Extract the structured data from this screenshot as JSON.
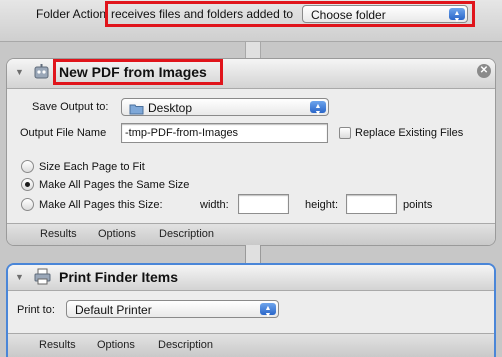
{
  "workflow_header": {
    "prefix_label": "Folder Action",
    "trigger_label": "receives files and folders added to",
    "folder_popup_value": "Choose folder"
  },
  "action1": {
    "title": "New PDF from Images",
    "save_output_label": "Save Output to:",
    "save_output_value": "Desktop",
    "output_file_name_label": "Output File Name",
    "output_file_name_value": "-tmp-PDF-from-Images",
    "replace_existing_label": "Replace Existing Files",
    "radio_size_each": "Size Each Page to Fit",
    "radio_make_same": "Make All Pages the Same Size",
    "radio_make_this": "Make All Pages this Size:",
    "width_label": "width:",
    "width_value": "",
    "height_label": "height:",
    "height_value": "",
    "points_label": "points",
    "footer_tabs": [
      "Results",
      "Options",
      "Description"
    ]
  },
  "action2": {
    "title": "Print Finder Items",
    "print_to_label": "Print to:",
    "print_to_value": "Default Printer",
    "footer_tabs": [
      "Results",
      "Options",
      "Description"
    ]
  },
  "colors": {
    "highlight_red": "#e0141b",
    "selected_blue": "#4a86d8",
    "popup_blue": "#2a66c9"
  },
  "icons": [
    "automator-icon",
    "folder-icon",
    "close-icon",
    "disclosure-triangle-icon",
    "popup-arrows-icon"
  ]
}
